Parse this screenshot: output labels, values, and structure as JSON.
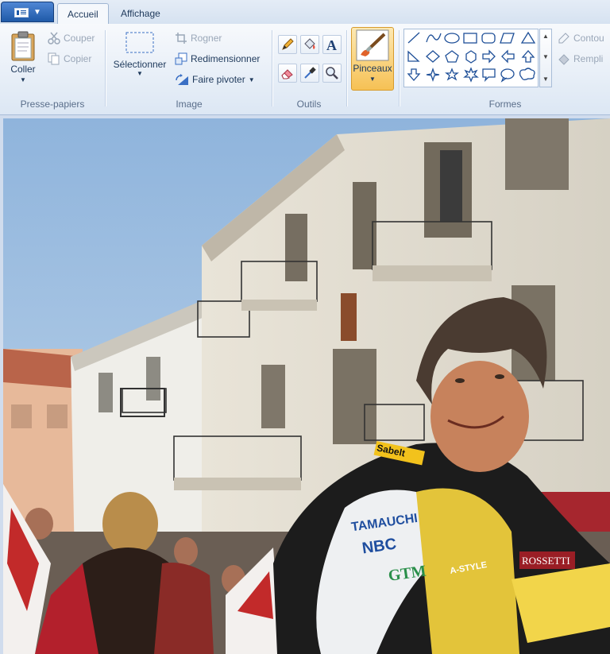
{
  "tabs": {
    "home": "Accueil",
    "view": "Affichage"
  },
  "clipboard": {
    "paste": "Coller",
    "cut": "Couper",
    "copy": "Copier",
    "group_label": "Presse-papiers"
  },
  "image": {
    "select": "Sélectionner",
    "crop": "Rogner",
    "resize": "Redimensionner",
    "rotate": "Faire pivoter",
    "group_label": "Image"
  },
  "tools": {
    "group_label": "Outils"
  },
  "brushes": {
    "label": "Pinceaux"
  },
  "shapes": {
    "group_label": "Formes",
    "outline": "Contou",
    "fill": "Rempli"
  },
  "photo": {
    "sponsors": [
      "Sabelt",
      "TAMAUCHI",
      "NBC",
      "GTM",
      "A-STYLE",
      "ROSSETTI"
    ]
  },
  "colors": {
    "accent": "#1f5aa8",
    "brush_active": "#f6c155",
    "sky": "#aecbe8"
  }
}
